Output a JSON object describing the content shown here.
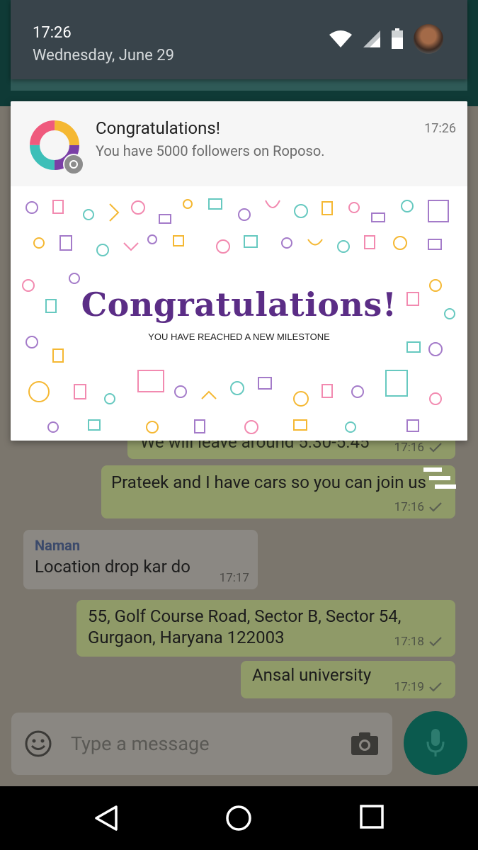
{
  "status_shade": {
    "time": "17:26",
    "date": "Wednesday, June 29"
  },
  "notification": {
    "title": "Congratulations!",
    "text": "You have 5000 followers on Roposo.",
    "time": "17:26",
    "banner_heading": "Congratulations!",
    "banner_subheading": "YOU HAVE REACHED A NEW MILESTONE"
  },
  "chat": {
    "messages": [
      {
        "direction": "out",
        "text": "We will leave around 5.30-5.45",
        "time": "17:16"
      },
      {
        "direction": "out",
        "text": "Prateek and I have cars so you can join us",
        "time": "17:16"
      },
      {
        "direction": "in",
        "sender": "Naman",
        "text": "Location drop kar do",
        "time": "17:17"
      },
      {
        "direction": "out",
        "text_line1": "55, Golf Course Road, Sector B, Sector 54,",
        "text_line2": "Gurgaon, Haryana 122003",
        "time": "17:18"
      },
      {
        "direction": "out",
        "text": "Ansal university",
        "time": "17:19"
      }
    ],
    "input_placeholder": "Type a message"
  },
  "colors": {
    "brand_purple": "#5b2d86",
    "chat_header": "#075e54",
    "outgoing_bubble": "#dcf8c6"
  }
}
